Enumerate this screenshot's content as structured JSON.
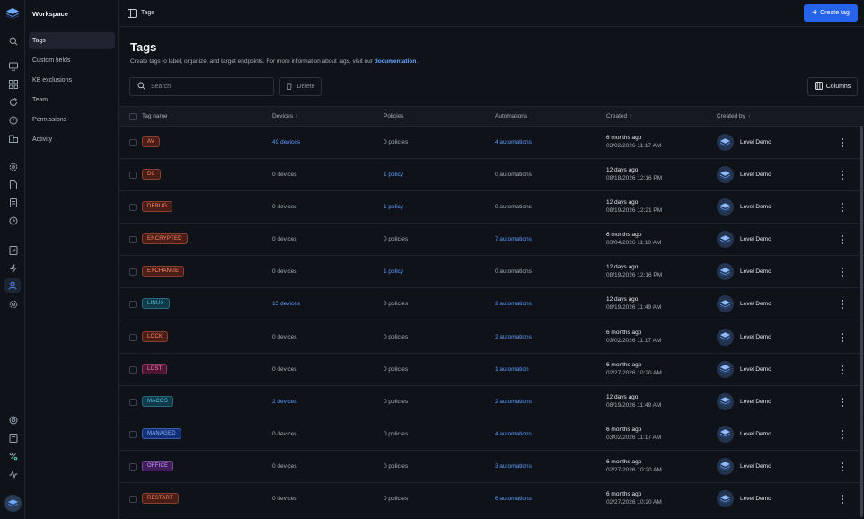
{
  "workspace": "Workspace",
  "breadcrumb": "Tags",
  "create_button": "Create tag",
  "sidebar": {
    "items": [
      {
        "label": "Tags",
        "active": true
      },
      {
        "label": "Custom fields"
      },
      {
        "label": "KB exclusions"
      },
      {
        "label": "Team"
      },
      {
        "label": "Permissions"
      },
      {
        "label": "Activity"
      }
    ]
  },
  "page": {
    "title": "Tags",
    "subtitle": "Create tags to label, organize, and target endpoints. For more information about tags, visit our",
    "subtitle_link": "documentation",
    "subtitle_end": "."
  },
  "toolbar": {
    "search_placeholder": "Search",
    "delete_label": "Delete",
    "columns_label": "Columns"
  },
  "columns": [
    "Tag name",
    "Devices",
    "Policies",
    "Automations",
    "Created",
    "Created by"
  ],
  "colors": {
    "accent": "#2563eb",
    "link": "#5d9bff",
    "tag_red_bg": "#4a1d16",
    "tag_red_fg": "#ff8a6b",
    "tag_teal_bg": "#0f3a4a",
    "tag_teal_fg": "#5cc8e8",
    "tag_blue_bg": "#12307a",
    "tag_blue_fg": "#8fb4ff",
    "tag_purple_bg": "#3f1c5c",
    "tag_purple_fg": "#d6a0ff",
    "tag_pink_bg": "#4e1433",
    "tag_pink_fg": "#ff86be"
  },
  "rows": [
    {
      "tag": "AV",
      "color": "red",
      "devices": "49 devices",
      "devices_link": true,
      "policies": "0 policies",
      "policies_link": false,
      "automations": "4 automations",
      "automations_link": true,
      "created_rel": "6 months ago",
      "created_abs": "03/02/2026 11:17 AM",
      "created_by": "Level Demo"
    },
    {
      "tag": "DC",
      "color": "red",
      "devices": "0 devices",
      "devices_link": false,
      "policies": "1 policy",
      "policies_link": true,
      "automations": "0 automations",
      "automations_link": false,
      "created_rel": "12 days ago",
      "created_abs": "08/18/2026 12:16 PM",
      "created_by": "Level Demo"
    },
    {
      "tag": "DEBUG",
      "color": "red",
      "devices": "0 devices",
      "devices_link": false,
      "policies": "1 policy",
      "policies_link": true,
      "automations": "0 automations",
      "automations_link": false,
      "created_rel": "12 days ago",
      "created_abs": "08/19/2026 12:21 PM",
      "created_by": "Level Demo"
    },
    {
      "tag": "ENCRYPTED",
      "color": "red",
      "devices": "0 devices",
      "devices_link": false,
      "policies": "0 policies",
      "policies_link": false,
      "automations": "7 automations",
      "automations_link": true,
      "created_rel": "6 months ago",
      "created_abs": "03/04/2026 11:10 AM",
      "created_by": "Level Demo"
    },
    {
      "tag": "EXCHANGE",
      "color": "red",
      "devices": "0 devices",
      "devices_link": false,
      "policies": "1 policy",
      "policies_link": true,
      "automations": "0 automations",
      "automations_link": false,
      "created_rel": "12 days ago",
      "created_abs": "08/19/2026 12:16 PM",
      "created_by": "Level Demo"
    },
    {
      "tag": "LINUX",
      "color": "teal",
      "devices": "15 devices",
      "devices_link": true,
      "policies": "0 policies",
      "policies_link": false,
      "automations": "2 automations",
      "automations_link": true,
      "created_rel": "12 days ago",
      "created_abs": "08/19/2026 11:49 AM",
      "created_by": "Level Demo"
    },
    {
      "tag": "LOCK",
      "color": "red",
      "devices": "0 devices",
      "devices_link": false,
      "policies": "0 policies",
      "policies_link": false,
      "automations": "2 automations",
      "automations_link": true,
      "created_rel": "6 months ago",
      "created_abs": "03/02/2026 11:17 AM",
      "created_by": "Level Demo"
    },
    {
      "tag": "LOST",
      "color": "pink",
      "devices": "0 devices",
      "devices_link": false,
      "policies": "0 policies",
      "policies_link": false,
      "automations": "1 automation",
      "automations_link": true,
      "created_rel": "6 months ago",
      "created_abs": "02/27/2026 10:20 AM",
      "created_by": "Level Demo"
    },
    {
      "tag": "MACOS",
      "color": "teal",
      "devices": "2 devices",
      "devices_link": true,
      "policies": "0 policies",
      "policies_link": false,
      "automations": "2 automations",
      "automations_link": true,
      "created_rel": "12 days ago",
      "created_abs": "08/19/2026 11:49 AM",
      "created_by": "Level Demo"
    },
    {
      "tag": "MANAGED",
      "color": "blue",
      "devices": "0 devices",
      "devices_link": false,
      "policies": "0 policies",
      "policies_link": false,
      "automations": "4 automations",
      "automations_link": true,
      "created_rel": "6 months ago",
      "created_abs": "03/02/2026 11:17 AM",
      "created_by": "Level Demo"
    },
    {
      "tag": "OFFICE",
      "color": "purple",
      "devices": "0 devices",
      "devices_link": false,
      "policies": "0 policies",
      "policies_link": false,
      "automations": "3 automations",
      "automations_link": true,
      "created_rel": "6 months ago",
      "created_abs": "02/27/2026 10:20 AM",
      "created_by": "Level Demo"
    },
    {
      "tag": "RESTART",
      "color": "red",
      "devices": "0 devices",
      "devices_link": false,
      "policies": "0 policies",
      "policies_link": false,
      "automations": "6 automations",
      "automations_link": true,
      "created_rel": "6 months ago",
      "created_abs": "02/27/2026 10:20 AM",
      "created_by": "Level Demo"
    }
  ]
}
